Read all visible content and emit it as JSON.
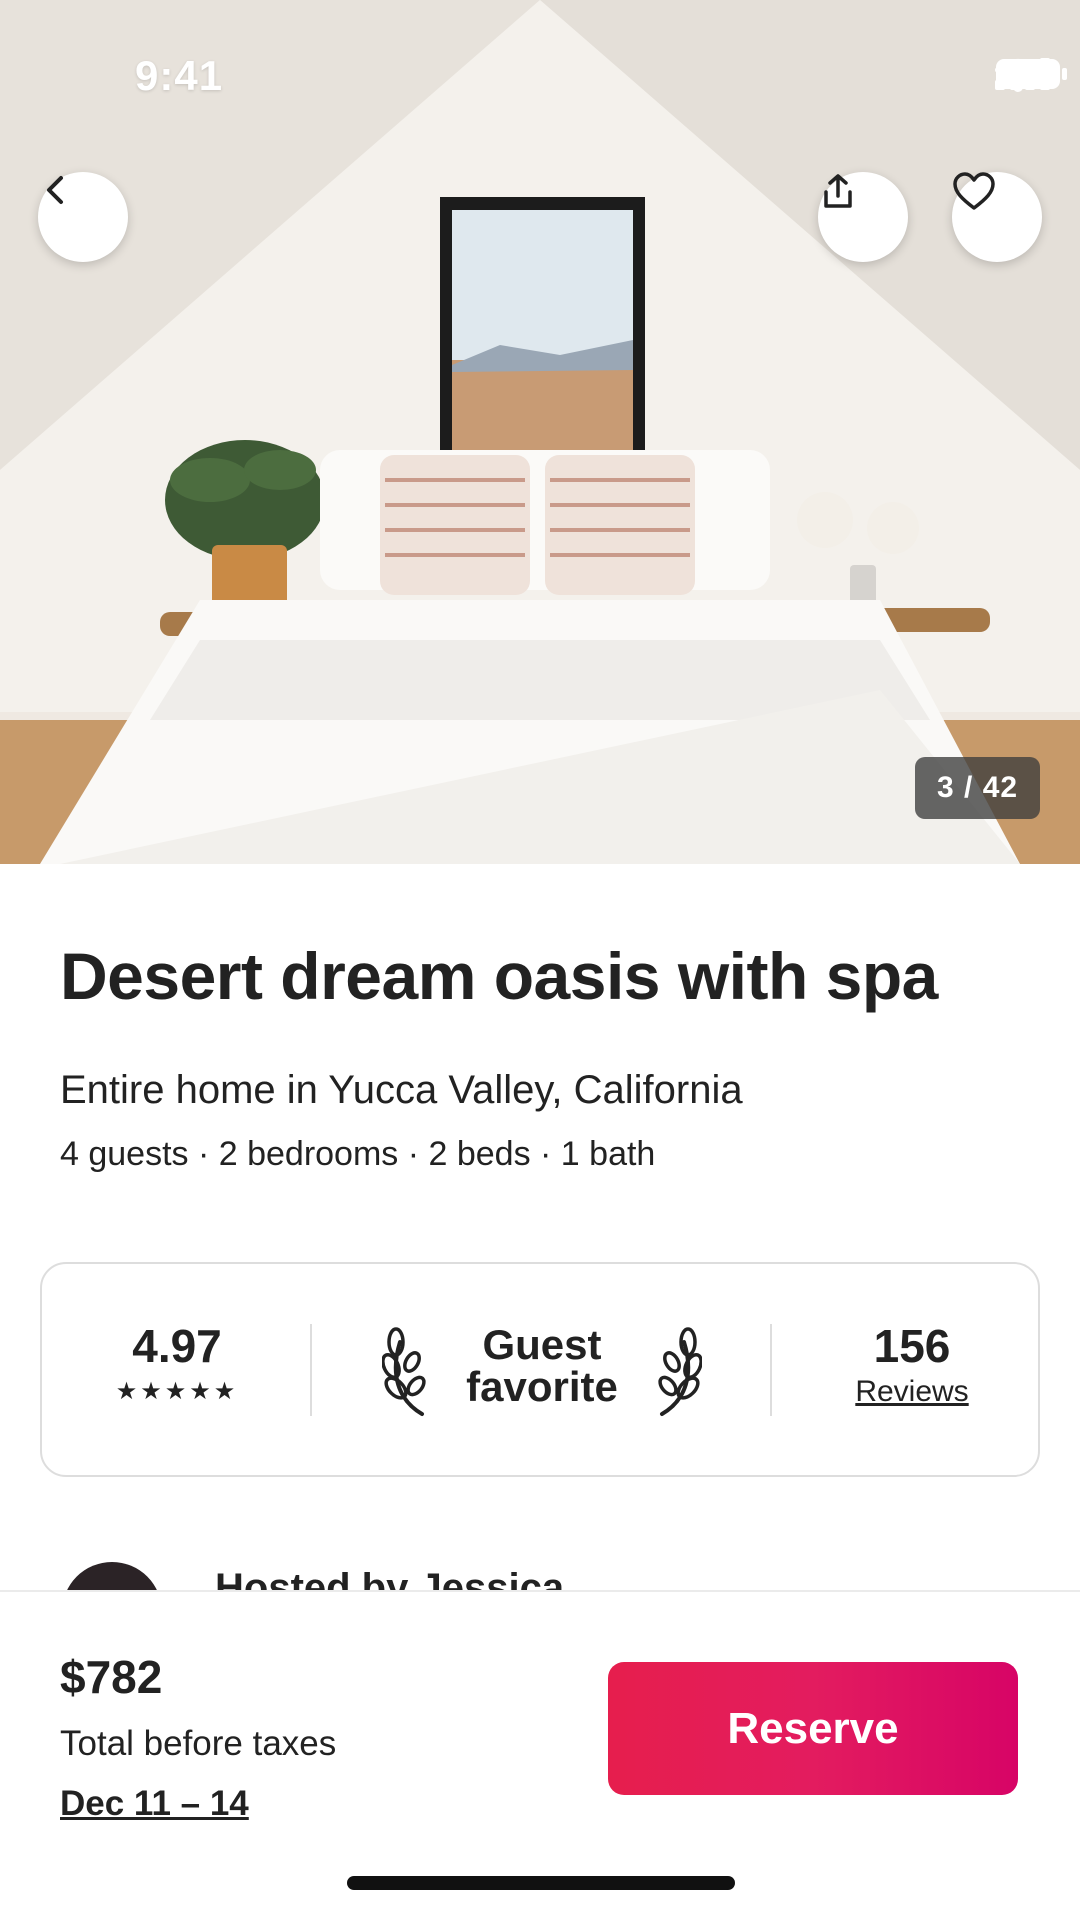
{
  "status_bar": {
    "time": "9:41"
  },
  "hero": {
    "photo_counter": "3 / 42",
    "icons": {
      "back": "chevron-left-icon",
      "share": "share-icon",
      "favorite": "heart-icon"
    }
  },
  "listing": {
    "title": "Desert dream oasis with spa",
    "subtitle": "Entire home in Yucca Valley, California",
    "details": "4 guests · 2 bedrooms · 2 beds · 1 bath"
  },
  "stats": {
    "rating": "4.97",
    "stars": "★★★★★",
    "guest_favorite_line1": "Guest",
    "guest_favorite_line2": "favorite",
    "reviews_count": "156",
    "reviews_label": "Reviews"
  },
  "host": {
    "text": "Hosted by Jessica"
  },
  "footer": {
    "price": "$782",
    "price_note": "Total before taxes",
    "dates": "Dec 11 – 14",
    "reserve_label": "Reserve"
  },
  "colors": {
    "accent": "#e31c5f",
    "text": "#222222",
    "border": "#dddddd"
  }
}
